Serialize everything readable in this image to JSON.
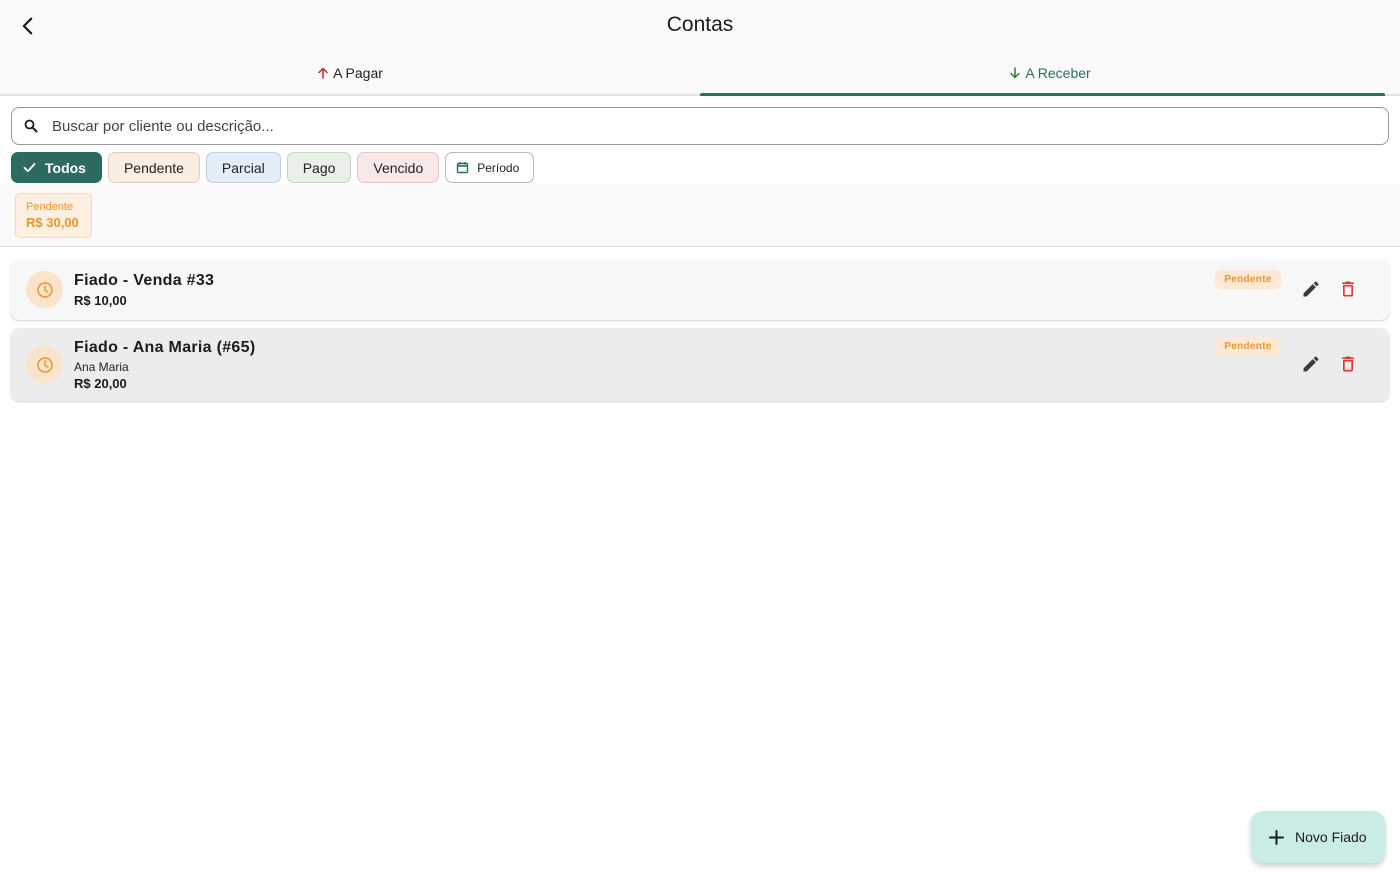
{
  "appbar": {
    "title": "Contas"
  },
  "tabs": [
    {
      "label": "A Pagar",
      "icon": "arrow-up-icon",
      "color": "#c62828"
    },
    {
      "label": "A Receber",
      "icon": "arrow-down-icon",
      "color": "#2e7d32",
      "selected": true
    }
  ],
  "search": {
    "placeholder": "Buscar por cliente ou descrição..."
  },
  "filters": [
    {
      "label": "Todos",
      "selected": true
    },
    {
      "label": "Pendente"
    },
    {
      "label": "Parcial"
    },
    {
      "label": "Pago"
    },
    {
      "label": "Vencido"
    },
    {
      "label": "Período",
      "icon": "calendar-icon"
    }
  ],
  "summary": {
    "label": "Pendente",
    "value": "R$ 30,00"
  },
  "items": [
    {
      "title": "Fiado - Venda #33",
      "value": "R$ 10,00",
      "status": "Pendente"
    },
    {
      "title": "Fiado - Ana Maria (#65)",
      "subtitle": "Ana Maria",
      "value": "R$ 20,00",
      "status": "Pendente"
    }
  ],
  "fab": {
    "label": "Novo Fiado"
  },
  "colors": {
    "primary": "#2d6b60",
    "pending": "#e8962e",
    "delete": "#e53935",
    "fab_bg": "#c9ece6"
  }
}
